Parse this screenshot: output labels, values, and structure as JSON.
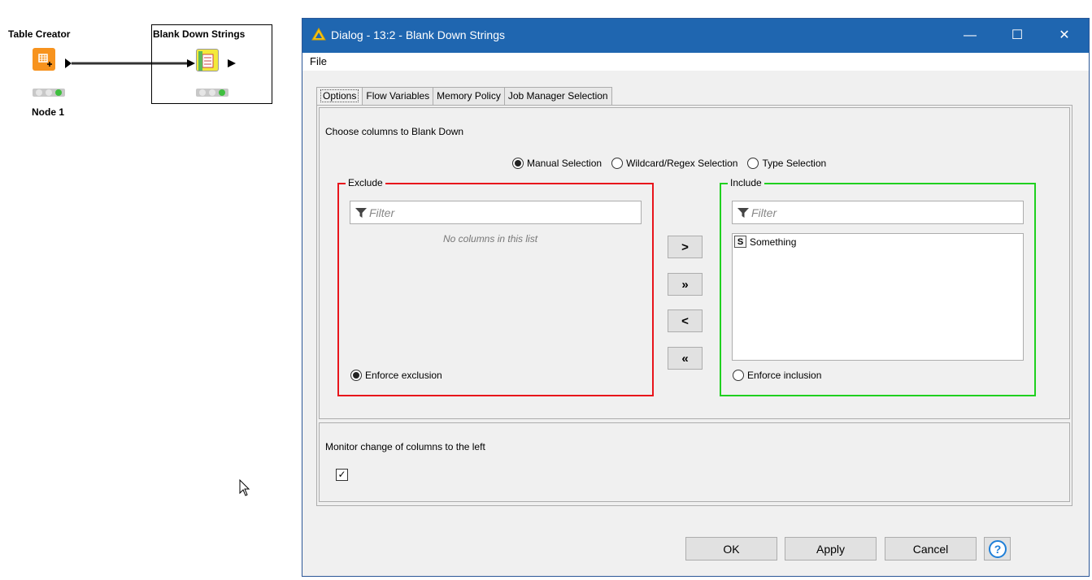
{
  "workflow": {
    "nodes": [
      {
        "title": "Table Creator",
        "label": "Node 1"
      },
      {
        "title": "Blank Down Strings",
        "label": ""
      }
    ]
  },
  "dialog": {
    "title": "Dialog - 13:2 - Blank Down Strings",
    "window_controls": {
      "minimize": "—",
      "maximize": "☐",
      "close": "✕"
    },
    "menu": [
      "File"
    ],
    "tabs": [
      "Options",
      "Flow Variables",
      "Memory Policy",
      "Job Manager Selection"
    ],
    "active_tab": "Options",
    "options": {
      "section_title": "Choose columns to Blank Down",
      "selection_modes": [
        "Manual Selection",
        "Wildcard/Regex Selection",
        "Type Selection"
      ],
      "selected_mode": "Manual Selection",
      "exclude": {
        "legend": "Exclude",
        "filter_placeholder": "Filter",
        "empty_text": "No columns in this list",
        "enforce_label": "Enforce exclusion",
        "enforce_selected": true,
        "border_color": "#e8141b"
      },
      "include": {
        "legend": "Include",
        "filter_placeholder": "Filter",
        "columns": [
          {
            "type": "S",
            "name": "Something"
          }
        ],
        "enforce_label": "Enforce inclusion",
        "enforce_selected": false,
        "border_color": "#1fd01f"
      },
      "move_buttons": [
        ">",
        "»",
        "<",
        "«"
      ],
      "monitor_label": "Monitor change of columns to the left",
      "monitor_checked": true,
      "monitor_check_glyph": "✓"
    },
    "buttons": {
      "ok": "OK",
      "apply": "Apply",
      "cancel": "Cancel",
      "help": "?"
    }
  },
  "colors": {
    "titlebar": "#1f66b0",
    "node_orange": "#f7931e",
    "status_green": "#3fbf3f"
  }
}
